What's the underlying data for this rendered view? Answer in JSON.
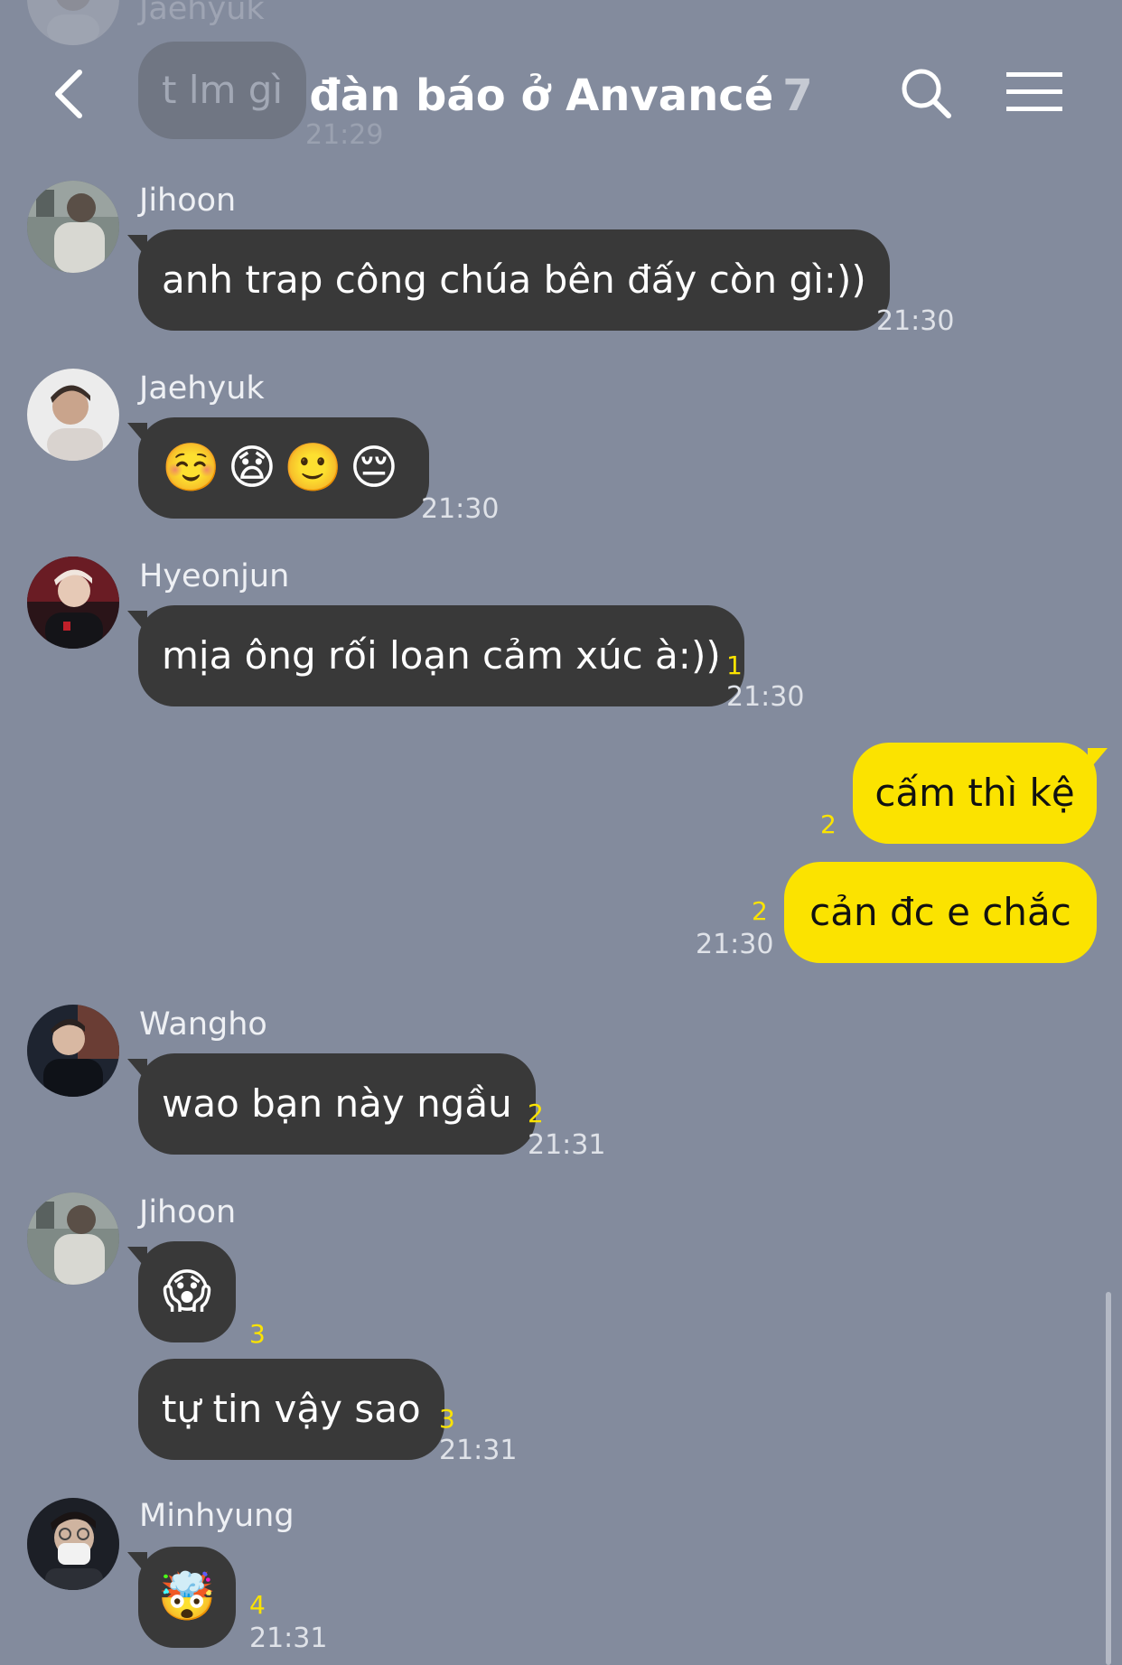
{
  "header": {
    "title": "đàn báo ở Anvancé",
    "member_count": "7",
    "back_icon": "chevron-left-icon",
    "search_icon": "search-icon",
    "menu_icon": "hamburger-menu-icon"
  },
  "faded_top": {
    "sender": "Jaehyuk",
    "text": "t lm gì",
    "time": "21:29"
  },
  "messages": [
    {
      "sender": "Jihoon",
      "text": "anh trap công chúa bên đấy còn gì:))",
      "time": "21:30"
    },
    {
      "sender": "Jaehyuk",
      "text": "☺️😧🙂😔",
      "time": "21:30"
    },
    {
      "sender": "Hyeonjun",
      "text": "mịa ông rối loạn cảm xúc à:))",
      "unread": "1",
      "time": "21:30"
    },
    {
      "mine": true,
      "text": "cấm thì kệ",
      "unread": "2"
    },
    {
      "mine": true,
      "text": "cản đc e chắc",
      "unread": "2",
      "time": "21:30"
    },
    {
      "sender": "Wangho",
      "text": "wao bạn này ngầu",
      "unread": "2",
      "time": "21:31"
    },
    {
      "sender": "Jihoon",
      "text": "😱",
      "unread": "3"
    },
    {
      "text": "tự tin vậy sao",
      "unread": "3",
      "time": "21:31"
    },
    {
      "sender": "Minhyung",
      "text": "🤯",
      "unread": "4",
      "time": "21:31"
    }
  ],
  "colors": {
    "background": "#838b9d",
    "bubble_other": "#393939",
    "bubble_mine": "#fbe300",
    "unread_count": "#fbe300"
  }
}
